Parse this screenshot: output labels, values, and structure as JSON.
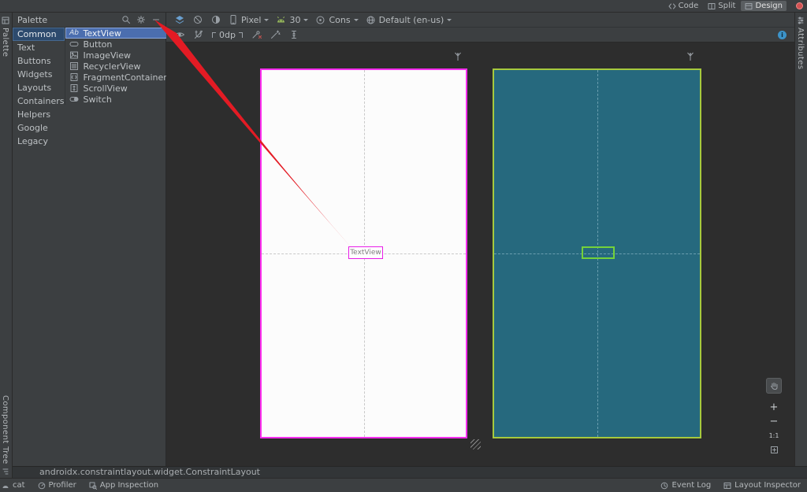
{
  "colors": {
    "selection_blue": "#4b6eaf",
    "design_selection_magenta": "#ff2ef0",
    "blueprint_fill": "#26697e",
    "blueprint_border": "#a6c93d",
    "blueprint_widget_green": "#74d23a",
    "annotation_arrow_red": "#e31b24",
    "info_blue": "#3c93c9"
  },
  "top_bar": {
    "tabs": [
      {
        "label": "Code"
      },
      {
        "label": "Split"
      },
      {
        "label": "Design",
        "active": true
      }
    ]
  },
  "rails": {
    "left_top": "Palette",
    "left_bottom": "Component Tree",
    "right_top": "Attributes"
  },
  "palette": {
    "title": "Palette",
    "categories": [
      "Common",
      "Text",
      "Buttons",
      "Widgets",
      "Layouts",
      "Containers",
      "Helpers",
      "Google",
      "Legacy"
    ],
    "selected_category": "Common",
    "components": [
      {
        "icon_text": "Ab",
        "label": "TextView",
        "selected": true
      },
      {
        "label": "Button"
      },
      {
        "label": "ImageView"
      },
      {
        "label": "RecyclerView"
      },
      {
        "label": "FragmentContainerView"
      },
      {
        "label": "ScrollView"
      },
      {
        "label": "Switch"
      }
    ]
  },
  "design_toolbar": {
    "device": "Pixel",
    "api_level": "30",
    "theme": "Cons",
    "locale": "Default (en-us)"
  },
  "constraint_toolbar": {
    "default_margin": "0dp"
  },
  "canvas": {
    "textview_label": "TextView"
  },
  "zoom_controls": {
    "zoom_in": "+",
    "zoom_out": "−",
    "one_to_one": "1:1"
  },
  "breadcrumb": "androidx.constraintlayout.widget.ConstraintLayout",
  "bottom_bar": {
    "left": [
      {
        "label": "cat"
      },
      {
        "label": "Profiler"
      },
      {
        "label": "App Inspection"
      }
    ],
    "right": [
      {
        "label": "Event Log"
      },
      {
        "label": "Layout Inspector"
      }
    ]
  }
}
